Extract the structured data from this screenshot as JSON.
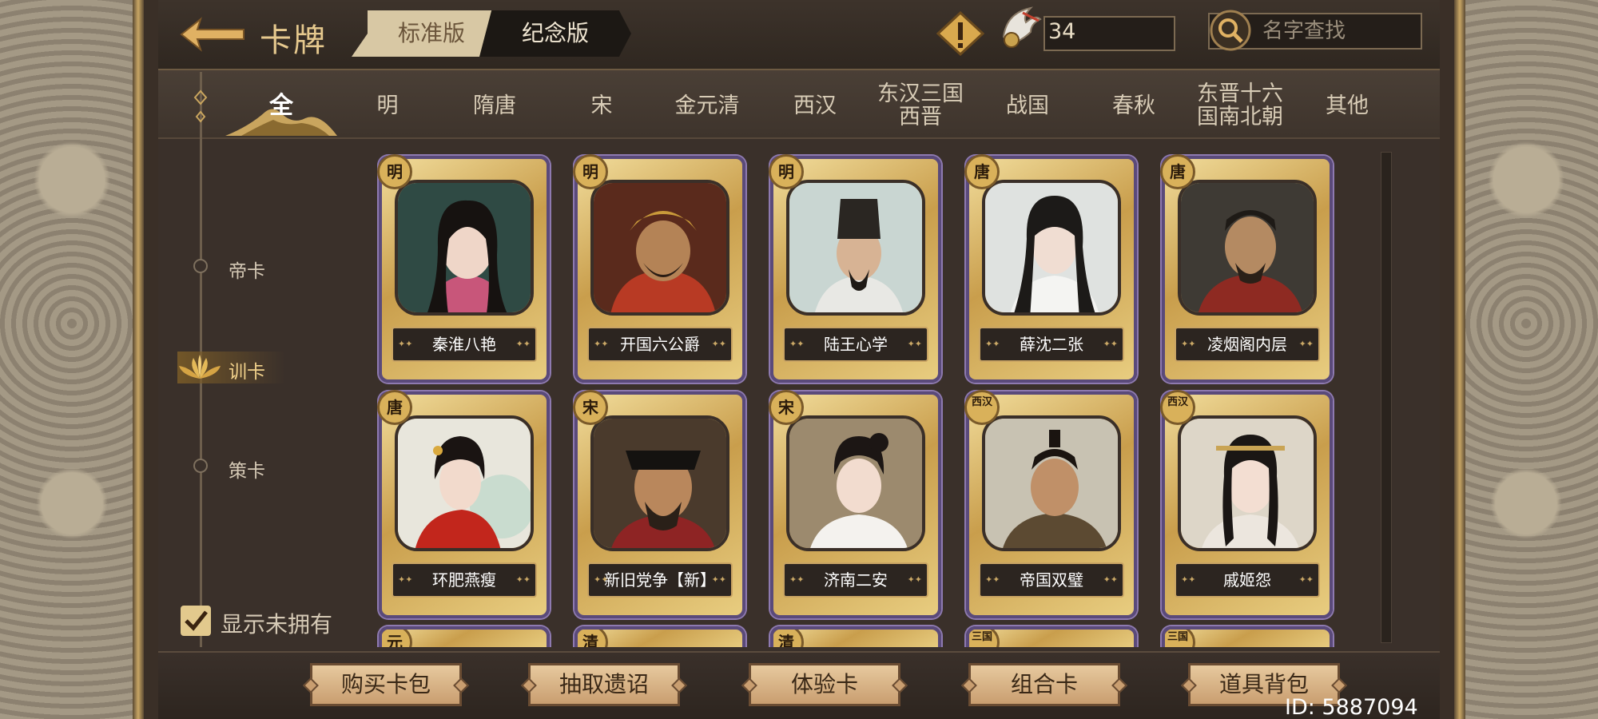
{
  "header": {
    "title": "卡牌",
    "version_tabs": [
      "标准版",
      "纪念版"
    ],
    "currency_value": "34",
    "search_placeholder": "名字查找"
  },
  "dynasty_tabs": [
    "全",
    "明",
    "隋唐",
    "宋",
    "金元清",
    "西汉",
    "东汉三国\n西晋",
    "战国",
    "春秋",
    "东晋十六\n国南北朝",
    "其他"
  ],
  "side_menu": [
    "帝卡",
    "训卡",
    "策卡"
  ],
  "active_side_menu": "训卡",
  "show_unowned_label": "显示未拥有",
  "show_unowned_checked": true,
  "cards": [
    {
      "badge": "明",
      "name": "秦淮八艳"
    },
    {
      "badge": "明",
      "name": "开国六公爵"
    },
    {
      "badge": "明",
      "name": "陆王心学"
    },
    {
      "badge": "唐",
      "name": "薛沈二张"
    },
    {
      "badge": "唐",
      "name": "凌烟阁内层"
    },
    {
      "badge": "唐",
      "name": "环肥燕瘦"
    },
    {
      "badge": "宋",
      "name": "新旧党争【新】"
    },
    {
      "badge": "宋",
      "name": "济南二安"
    },
    {
      "badge": "西汉",
      "name": "帝国双璧"
    },
    {
      "badge": "西汉",
      "name": "戚姬怨"
    }
  ],
  "partial_card_badges": [
    "元",
    "清",
    "清",
    "三国",
    "三国"
  ],
  "bottom_buttons": [
    "购买卡包",
    "抽取遗诏",
    "体验卡",
    "组合卡",
    "道具背包"
  ],
  "user_id": "ID: 5887094",
  "colors": {
    "gold": "#e6c98e",
    "panel": "#3a302a",
    "card_frame": "#5a4a7a"
  }
}
